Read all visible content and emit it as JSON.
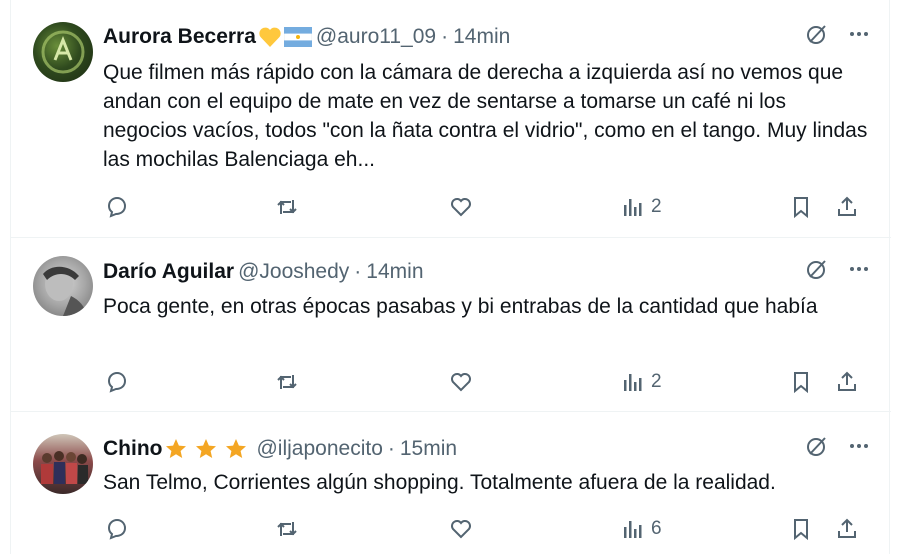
{
  "posts": [
    {
      "name": "Aurora Becerra",
      "handle": "@auro11_09",
      "separator": "·",
      "time": "14min",
      "text": "Que filmen más rápido con la cámara de derecha a izquierda así no vemos que andan con el equipo de mate en vez de sentarse a tomarse un café ni los negocios vacíos, todos \"con la ñata contra el vidrio\", como en el tango. Muy lindas las mochilas Balenciaga eh...",
      "views": "2",
      "name_emojis": [
        "yellow-heart-icon",
        "argentina-flag-icon"
      ]
    },
    {
      "name": "Darío Aguilar",
      "handle": "@Jooshedy",
      "separator": "·",
      "time": "14min",
      "text": "Poca gente, en otras épocas pasabas y bi entrabas de la cantidad que había",
      "views": "2",
      "name_emojis": []
    },
    {
      "name": "Chino",
      "handle": "@iljaponecito",
      "separator": "·",
      "time": "15min",
      "text": "San Telmo, Corrientes algún shopping. Totalmente afuera de la realidad.",
      "views": "6",
      "name_emojis": [
        "star-icon",
        "star-icon",
        "star-icon"
      ]
    }
  ],
  "colors": {
    "text": "#0f1419",
    "secondary": "#536471",
    "divider": "#eff3f4",
    "star": "#f4a623",
    "heart": "#ffc83d",
    "flag_blue": "#74acdf"
  }
}
